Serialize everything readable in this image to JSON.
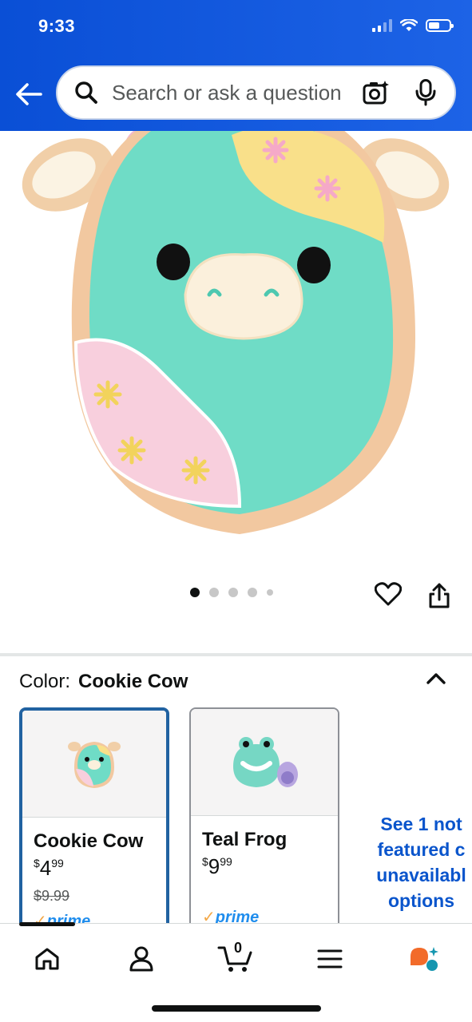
{
  "status_bar": {
    "time": "9:33"
  },
  "search": {
    "placeholder": "Search or ask a question"
  },
  "carousel": {
    "total_images": 5,
    "active_index": 0
  },
  "variations": {
    "label": "Color:",
    "selected": "Cookie Cow",
    "options": [
      {
        "name": "Cookie Cow",
        "price_symbol": "$",
        "price_whole": "4",
        "price_fraction": "99",
        "list_price": "$9.99",
        "prime": "prime",
        "selected": true
      },
      {
        "name": "Teal Frog",
        "price_symbol": "$",
        "price_whole": "9",
        "price_fraction": "99",
        "prime": "prime",
        "selected": false
      }
    ],
    "see_more_lines": [
      "See 1 not",
      "featured c",
      "unavailabl",
      "options"
    ]
  },
  "bottom_nav": {
    "items": [
      "home-icon",
      "account-icon",
      "cart-icon",
      "menu-icon",
      "rufus-icon"
    ],
    "cart_count": "0"
  },
  "colors": {
    "header_blue": "#0a4fd6",
    "link_blue": "#0a55cc",
    "selected_border": "#2162a1",
    "prime_blue": "#1f8ded"
  }
}
